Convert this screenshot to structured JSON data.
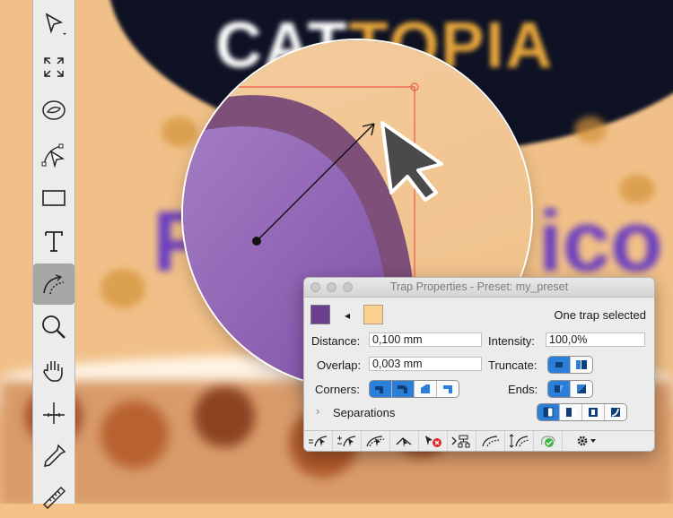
{
  "artwork": {
    "title_white": "CAT",
    "title_orange": "TOPIA",
    "purple_left": "Pl",
    "purple_right": "ico"
  },
  "colors": {
    "accent_blue": "#2c7fd8",
    "trap_from": "#6d3f8f",
    "trap_to": "#fcd190",
    "lens_purple": "#8a60b8",
    "lens_band": "#7d4f79"
  },
  "toolbar": {
    "tools": [
      {
        "name": "selection-tool",
        "icon": "arrow-pointer-icon"
      },
      {
        "name": "zoom-fit-tool",
        "icon": "expand-arrows-icon"
      },
      {
        "name": "object-tool",
        "icon": "object-eye-icon"
      },
      {
        "name": "path-select-tool",
        "icon": "path-nodes-icon"
      },
      {
        "name": "rectangle-tool",
        "icon": "rectangle-icon"
      },
      {
        "name": "text-tool",
        "icon": "text-T-icon"
      },
      {
        "name": "trap-tool",
        "icon": "trap-curve-icon",
        "active": true
      },
      {
        "name": "zoom-tool",
        "icon": "magnifier-icon"
      },
      {
        "name": "hand-tool",
        "icon": "hand-icon"
      },
      {
        "name": "measure-tool",
        "icon": "crosshair-ruler-icon"
      },
      {
        "name": "eyedropper-tool",
        "icon": "eyedropper-icon"
      },
      {
        "name": "ruler-tool",
        "icon": "ruler-icon"
      }
    ]
  },
  "panel": {
    "title": "Trap Properties - Preset: my_preset",
    "status": "One trap selected",
    "distance_label": "Distance:",
    "distance_value": "0,100 mm",
    "intensity_label": "Intensity:",
    "intensity_value": "100,0%",
    "overlap_label": "Overlap:",
    "overlap_value": "0,003 mm",
    "truncate_label": "Truncate:",
    "corners_label": "Corners:",
    "ends_label": "Ends:",
    "separations_label": "Separations",
    "direction_glyph": "◂"
  }
}
